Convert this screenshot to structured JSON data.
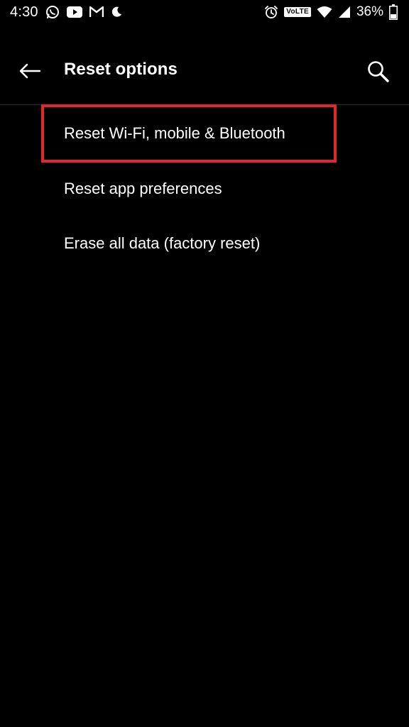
{
  "status_bar": {
    "time": "4:30",
    "notification_icons": [
      "whatsapp-icon",
      "youtube-icon",
      "gmail-icon",
      "moon-icon"
    ],
    "alarm_icon": "alarm-icon",
    "volte_label": "VoLTE",
    "wifi_icon": "wifi-icon",
    "signal_icon": "signal-icon",
    "battery_percent": "36%",
    "battery_level": 0.36
  },
  "app_bar": {
    "title": "Reset options",
    "back_icon": "arrow-left-icon",
    "search_icon": "search-icon"
  },
  "options": [
    {
      "label": "Reset Wi-Fi, mobile & Bluetooth",
      "highlighted": true
    },
    {
      "label": "Reset app preferences",
      "highlighted": false
    },
    {
      "label": "Erase all data (factory reset)",
      "highlighted": false
    }
  ],
  "colors": {
    "background": "#000000",
    "text": "#ffffff",
    "highlight": "#e3252c"
  }
}
